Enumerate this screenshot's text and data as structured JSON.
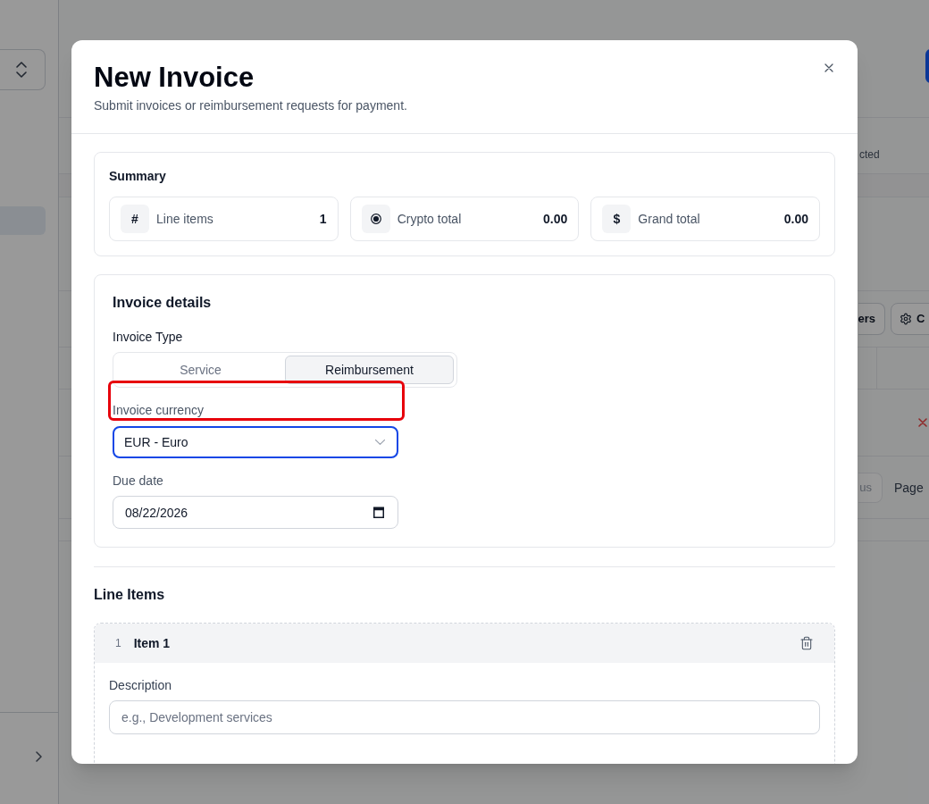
{
  "app": {
    "sidebar": {
      "nav_items": [
        {
          "selected": true
        }
      ]
    },
    "main": {
      "selection_label": "cted",
      "toolbar": [
        {
          "kind": "plain",
          "label": "ers"
        },
        {
          "kind": "settings",
          "label": "C"
        }
      ],
      "pagination": {
        "previous": {
          "label": "us",
          "disabled": true
        },
        "page_label": "Page"
      }
    }
  },
  "dialog": {
    "title": "New Invoice",
    "subtitle": "Submit invoices or reimbursement requests for payment.",
    "summary": {
      "title": "Summary",
      "stats": [
        {
          "kind": "count",
          "symbol": "#",
          "label": "Line items",
          "value": "1"
        },
        {
          "kind": "crypto",
          "label": "Crypto total",
          "value": "0.00"
        },
        {
          "kind": "amount",
          "symbol": "$",
          "label": "Grand total",
          "value": "0.00"
        }
      ]
    },
    "details": {
      "title": "Invoice details",
      "invoice_type": {
        "label": "Invoice Type",
        "options": [
          {
            "label": "Service",
            "selected": false
          },
          {
            "label": "Reimbursement",
            "selected": true
          }
        ]
      },
      "currency": {
        "label": "Invoice currency",
        "value": "EUR - Euro",
        "focused": true,
        "highlighted": true
      },
      "due_date": {
        "label": "Due date",
        "value": "08/22/2026"
      }
    },
    "line_items": {
      "title": "Line Items",
      "items": [
        {
          "number": "1",
          "title": "Item 1",
          "description": {
            "label": "Description",
            "placeholder": "e.g., Development services"
          }
        }
      ]
    }
  }
}
